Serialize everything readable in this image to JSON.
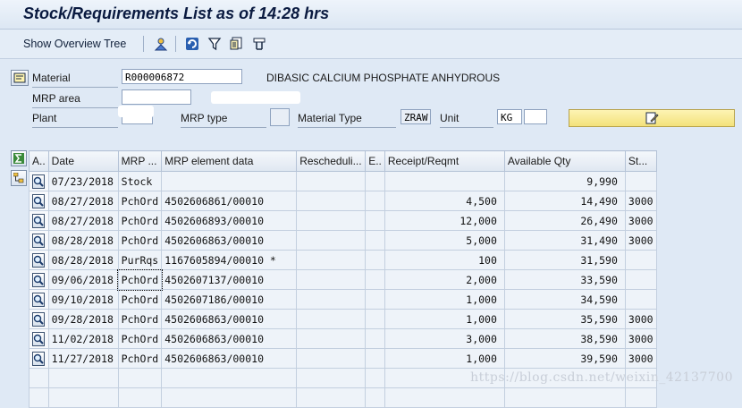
{
  "window": {
    "title": "Stock/Requirements List as of 14:28 hrs"
  },
  "toolbar": {
    "show_overview_tree": "Show Overview Tree",
    "icons": [
      "person-icon",
      "refresh-icon",
      "filter-icon",
      "details-icon",
      "settings-icon"
    ]
  },
  "header": {
    "material_label": "Material",
    "material_value": "R000006872",
    "material_desc": "DIBASIC CALCIUM PHOSPHATE ANHYDROUS",
    "mrp_area_label": "MRP area",
    "plant_label": "Plant",
    "mrp_type_label": "MRP type",
    "material_type_label": "Material Type",
    "material_type_value": "ZRAW",
    "unit_label": "Unit",
    "unit_value": "KG"
  },
  "table": {
    "columns": [
      "A..",
      "Date",
      "MRP ...",
      "MRP element data",
      "Rescheduli...",
      "E..",
      "Receipt/Reqmt",
      "Available Qty",
      "St..."
    ],
    "rows": [
      {
        "date": "07/23/2018",
        "mrp": "Stock",
        "element": "",
        "resched": "",
        "e": "",
        "receipt": "",
        "avail": "9,990",
        "st": ""
      },
      {
        "date": "08/27/2018",
        "mrp": "PchOrd",
        "element": "4502606861/00010",
        "resched": "",
        "e": "",
        "receipt": "4,500",
        "avail": "14,490",
        "st": "3000"
      },
      {
        "date": "08/27/2018",
        "mrp": "PchOrd",
        "element": "4502606893/00010",
        "resched": "",
        "e": "",
        "receipt": "12,000",
        "avail": "26,490",
        "st": "3000"
      },
      {
        "date": "08/28/2018",
        "mrp": "PchOrd",
        "element": "4502606863/00010",
        "resched": "",
        "e": "",
        "receipt": "5,000",
        "avail": "31,490",
        "st": "3000"
      },
      {
        "date": "08/28/2018",
        "mrp": "PurRqs",
        "element": "1167605894/00010 *",
        "resched": "",
        "e": "",
        "receipt": "100",
        "avail": "31,590",
        "st": ""
      },
      {
        "date": "09/06/2018",
        "mrp": "PchOrd",
        "element": "4502607137/00010",
        "resched": "",
        "e": "",
        "receipt": "2,000",
        "avail": "33,590",
        "st": ""
      },
      {
        "date": "09/10/2018",
        "mrp": "PchOrd",
        "element": "4502607186/00010",
        "resched": "",
        "e": "",
        "receipt": "1,000",
        "avail": "34,590",
        "st": ""
      },
      {
        "date": "09/28/2018",
        "mrp": "PchOrd",
        "element": "4502606863/00010",
        "resched": "",
        "e": "",
        "receipt": "1,000",
        "avail": "35,590",
        "st": "3000"
      },
      {
        "date": "11/02/2018",
        "mrp": "PchOrd",
        "element": "4502606863/00010",
        "resched": "",
        "e": "",
        "receipt": "3,000",
        "avail": "38,590",
        "st": "3000"
      },
      {
        "date": "11/27/2018",
        "mrp": "PchOrd",
        "element": "4502606863/00010",
        "resched": "",
        "e": "",
        "receipt": "1,000",
        "avail": "39,590",
        "st": "3000"
      }
    ]
  },
  "watermark": "https://blog.csdn.net/weixin_42137700"
}
